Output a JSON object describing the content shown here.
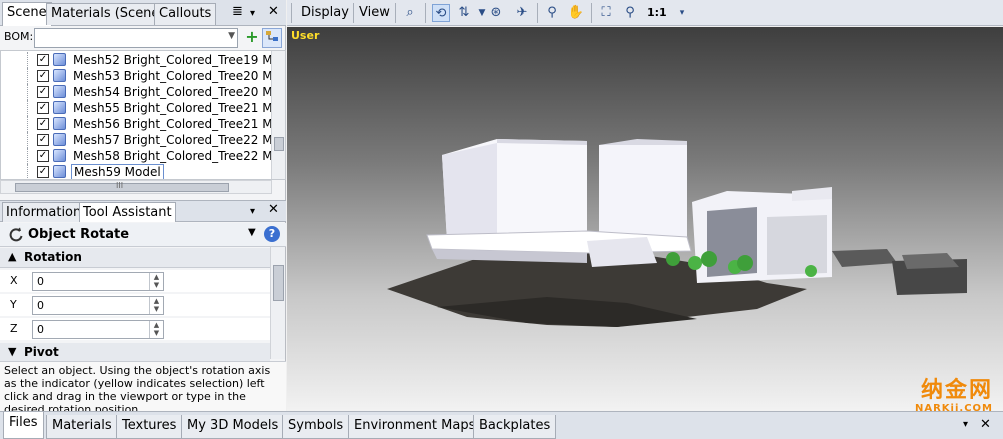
{
  "scene_panel": {
    "tabs": [
      {
        "label": "Scene"
      },
      {
        "label": "Materials (Scene)"
      },
      {
        "label": "Callouts"
      }
    ],
    "menu_glyph": "≣",
    "pin_glyph": "▾",
    "close_glyph": "✕",
    "bom_label": "BOM:",
    "add_glyph": "+",
    "tree_items": [
      {
        "label": "Mesh52 Bright_Colored_Tree19 M"
      },
      {
        "label": "Mesh53 Bright_Colored_Tree20 M"
      },
      {
        "label": "Mesh54 Bright_Colored_Tree20 M"
      },
      {
        "label": "Mesh55 Bright_Colored_Tree21 M"
      },
      {
        "label": "Mesh56 Bright_Colored_Tree21 M"
      },
      {
        "label": "Mesh57 Bright_Colored_Tree22 M"
      },
      {
        "label": "Mesh58 Bright_Colored_Tree22 M"
      },
      {
        "label": "Mesh59 Model"
      }
    ],
    "hscroll_glyph": "III"
  },
  "tool_panel": {
    "tabs": [
      {
        "label": "Information"
      },
      {
        "label": "Tool Assistant"
      }
    ],
    "pin_glyph": "▾",
    "close_glyph": "✕",
    "tool_name": "Object Rotate",
    "rotation_section": "Rotation",
    "rotation_fields": [
      {
        "axis": "X",
        "value": "0"
      },
      {
        "axis": "Y",
        "value": "0"
      },
      {
        "axis": "Z",
        "value": "0"
      }
    ],
    "pivot_section": "Pivot",
    "help_text": "Select an object. Using the object's rotation axis as the indicator (yellow indicates selection) left click and drag in the viewport or type in the desired rotation position."
  },
  "toolbar": {
    "display_label": "Display",
    "view_label": "View",
    "zoom_label": "1:1"
  },
  "viewport": {
    "camera_label": "User"
  },
  "watermark": {
    "cn": "纳金网",
    "en": "NARKii.COM"
  },
  "bottom_tabs": [
    {
      "label": "Files"
    },
    {
      "label": "Materials"
    },
    {
      "label": "Textures"
    },
    {
      "label": "My 3D Models"
    },
    {
      "label": "Symbols"
    },
    {
      "label": "Environment Maps"
    },
    {
      "label": "Backplates"
    }
  ],
  "colors": {
    "accent": "#ffde2a",
    "watermark": "#f08a0b"
  }
}
